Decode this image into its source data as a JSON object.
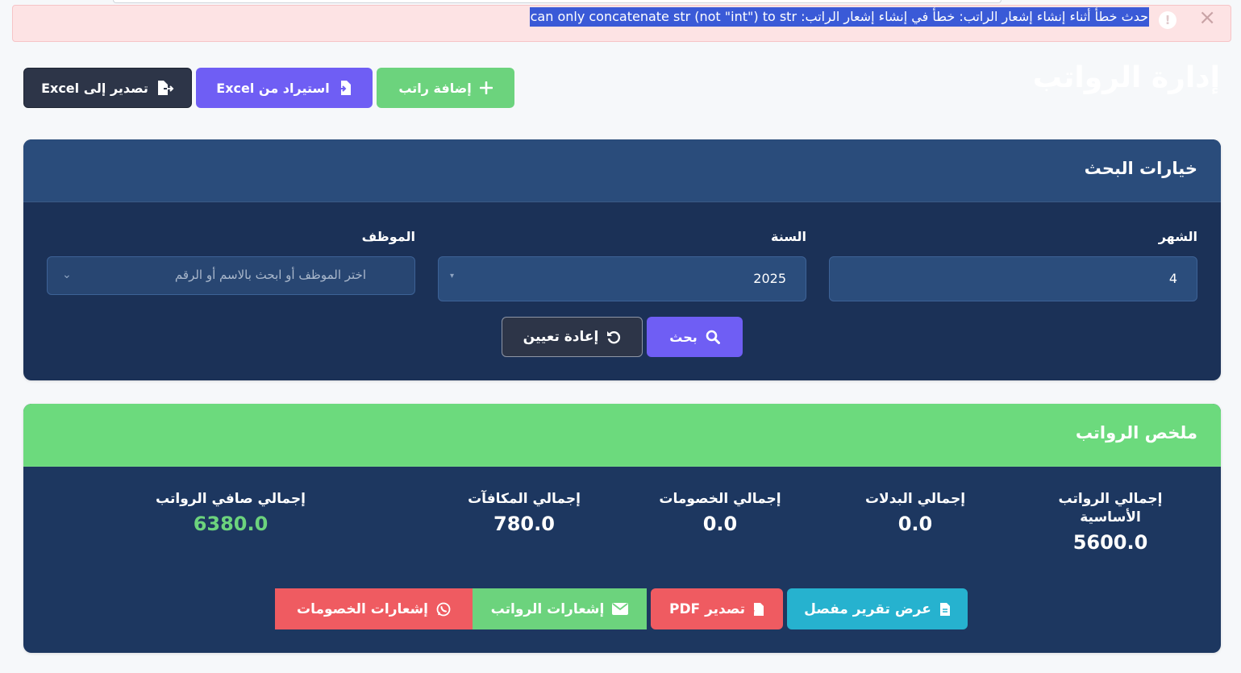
{
  "alert": {
    "message": "حدث خطأ أثناء إنشاء إشعار الراتب: خطأ في إنشاء إشعار الراتب: can only concatenate str (not \"int\") to str",
    "icon": "exclamation-icon",
    "close_icon": "close-icon"
  },
  "page": {
    "title": "إدارة الرواتب"
  },
  "actions": {
    "add_label": "إضافة راتب",
    "import_label": "استيراد من Excel",
    "export_label": "تصدير إلى Excel"
  },
  "search": {
    "title": "خيارات البحث",
    "month_label": "الشهر",
    "month_value": "4",
    "year_label": "السنة",
    "year_value": "2025",
    "employee_label": "الموظف",
    "employee_placeholder": "اختر الموظف أو ابحث بالاسم أو الرقم",
    "search_button": "بحث",
    "reset_button": "إعادة تعيين"
  },
  "summary": {
    "title": "ملخص الرواتب",
    "stats": [
      {
        "label": "إجمالي الرواتب الأساسية",
        "value": "5600.0"
      },
      {
        "label": "إجمالي البدلات",
        "value": "0.0"
      },
      {
        "label": "إجمالي الخصومات",
        "value": "0.0"
      },
      {
        "label": "إجمالي المكافآت",
        "value": "780.0"
      },
      {
        "label": "إجمالي صافي الرواتب",
        "value": "6380.0"
      }
    ],
    "buttons": {
      "detailed_report": "عرض تقرير مفصل",
      "export_pdf": "تصدير PDF",
      "salary_notifications": "إشعارات الرواتب",
      "deduction_notifications": "إشعارات الخصومات"
    }
  },
  "colors": {
    "accent_purple": "#6f5ef4",
    "success_green": "#6cd37d",
    "danger_red": "#ef5b61",
    "info_cyan": "#26b2cf",
    "navy": "#1d3760"
  }
}
